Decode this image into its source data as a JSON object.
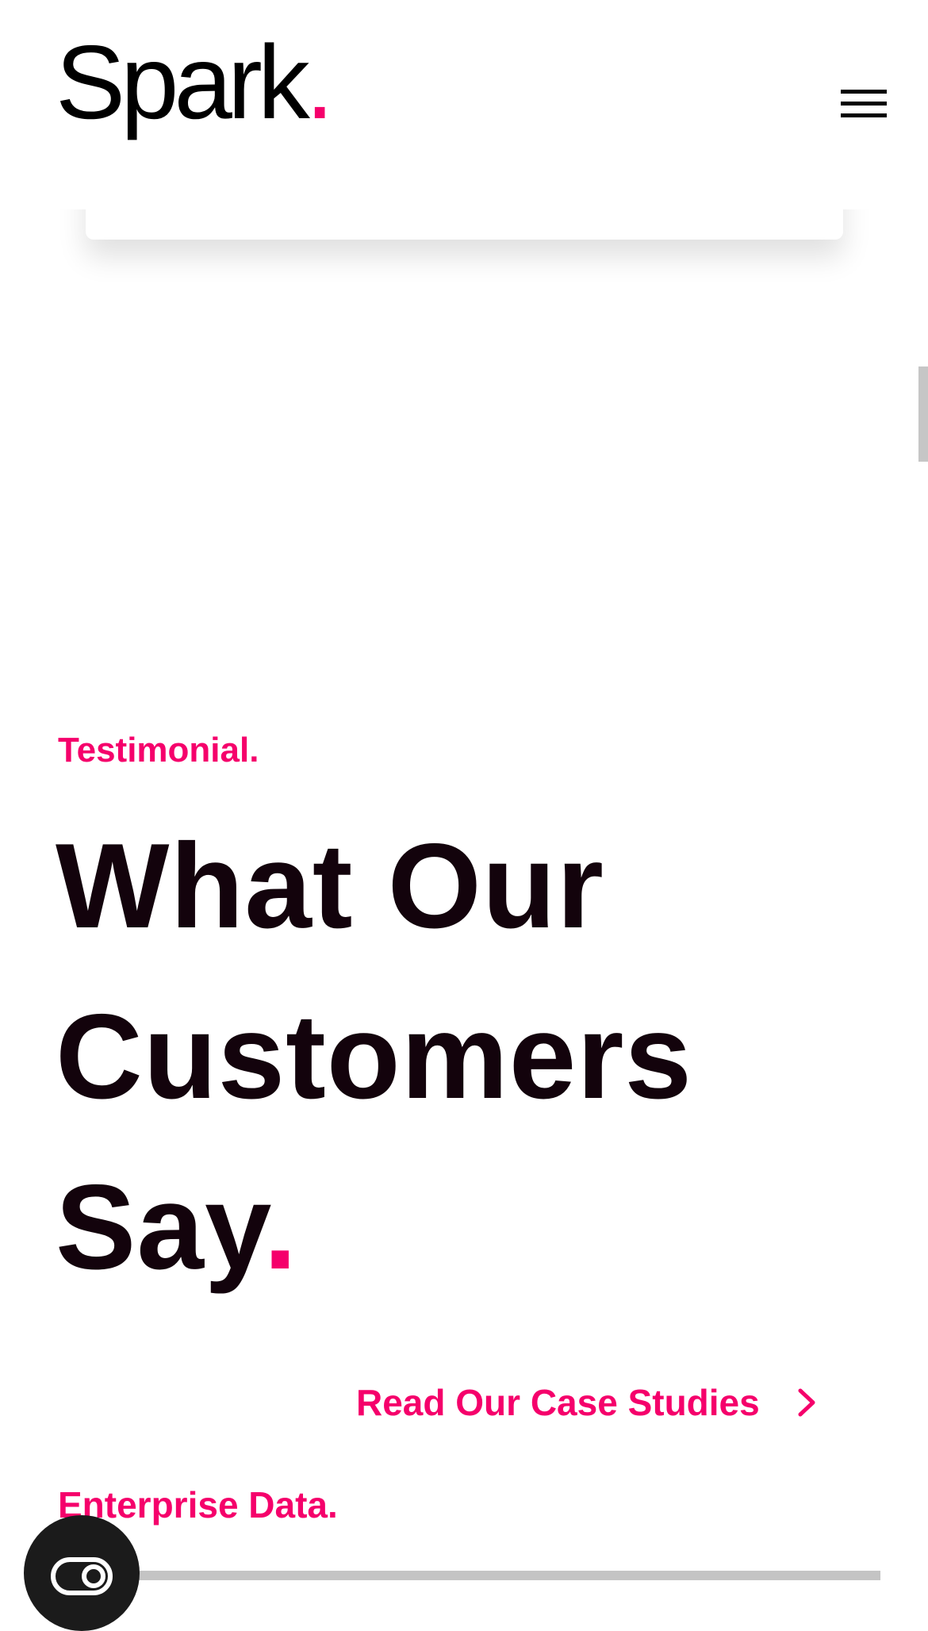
{
  "header": {
    "logo_text": "Spark",
    "logo_dot": ".",
    "menu_icon": "hamburger-menu-icon"
  },
  "testimonial": {
    "eyebrow": "Testimonial.",
    "headline_lines": [
      "What Our",
      "Customers",
      "Say"
    ],
    "headline_dot": ".",
    "case_link_label": "Read Our Case Studies",
    "case_link_icon": "chevron-right-icon"
  },
  "next_section": {
    "eyebrow": "Enterprise Data."
  },
  "floating_button": {
    "icon": "toggle-icon"
  },
  "colors": {
    "accent": "#f5006b",
    "text": "#13030c",
    "background": "#ffffff"
  }
}
